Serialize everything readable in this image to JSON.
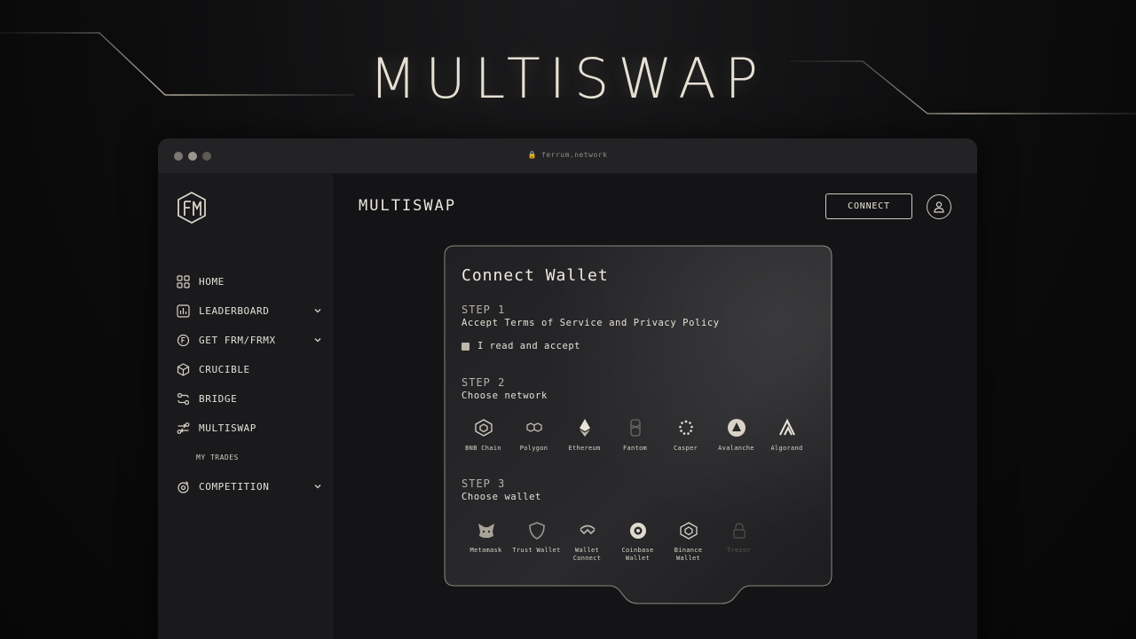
{
  "hero": {
    "title": "MULTISWAP"
  },
  "browser": {
    "url": "ferrum.network"
  },
  "sidebar": {
    "items": [
      {
        "label": "HOME"
      },
      {
        "label": "LEADERBOARD"
      },
      {
        "label": "GET FRM/FRMX"
      },
      {
        "label": "CRUCIBLE"
      },
      {
        "label": "BRIDGE"
      },
      {
        "label": "MULTISWAP"
      },
      {
        "label": "MY TRADES"
      },
      {
        "label": "COMPETITION"
      }
    ]
  },
  "header": {
    "title": "MULTISWAP",
    "connect_label": "CONNECT"
  },
  "wallet": {
    "title": "Connect Wallet",
    "step1": {
      "heading": "STEP 1",
      "desc": "Accept Terms of Service and Privacy Policy",
      "checkbox_label": "I read and accept"
    },
    "step2": {
      "heading": "STEP 2",
      "desc": "Choose network"
    },
    "step3": {
      "heading": "STEP 3",
      "desc": "Choose wallet"
    },
    "networks": [
      {
        "label": "BNB Chain",
        "icon": "bnb-icon"
      },
      {
        "label": "Polygon",
        "icon": "polygon-icon"
      },
      {
        "label": "Ethereum",
        "icon": "ethereum-icon"
      },
      {
        "label": "Fantom",
        "icon": "fantom-icon"
      },
      {
        "label": "Casper",
        "icon": "casper-icon"
      },
      {
        "label": "Avalanche",
        "icon": "avalanche-icon"
      },
      {
        "label": "Algorand",
        "icon": "algorand-icon"
      }
    ],
    "wallets": [
      {
        "label": "Metamask",
        "icon": "metamask-icon"
      },
      {
        "label": "Trust Wallet",
        "icon": "trust-wallet-icon"
      },
      {
        "label": "Wallet Connect",
        "icon": "walletconnect-icon"
      },
      {
        "label": "Coinbase Wallet",
        "icon": "coinbase-icon"
      },
      {
        "label": "Binance Wallet",
        "icon": "binance-icon"
      },
      {
        "label": "Trezor",
        "icon": "trezor-icon"
      }
    ]
  },
  "colors": {
    "accent": "#e6e0d4",
    "background": "#0c0c0d",
    "panel": "#1a1a1c"
  }
}
